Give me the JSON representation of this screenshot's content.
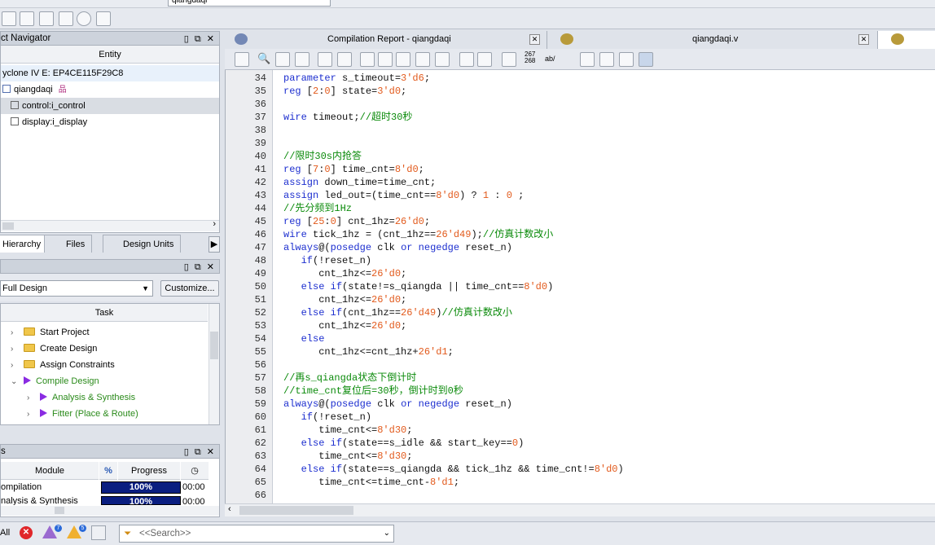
{
  "top_toolbar": {
    "project_combo": "qiangdaqi"
  },
  "project_navigator": {
    "title": "ct Navigator",
    "column_header": "Entity",
    "device": "yclone IV E: EP4CE115F29C8",
    "top_entity": "qiangdaqi",
    "children": [
      "control:i_control",
      "display:i_display"
    ],
    "tabs": [
      "Hierarchy",
      "Files",
      "Design Units"
    ]
  },
  "tasks": {
    "flow_select": "Full Design",
    "customize_label": "Customize...",
    "column_header": "Task",
    "items": [
      "Start Project",
      "Create Design",
      "Assign Constraints",
      "Compile Design",
      "Analysis & Synthesis",
      "Fitter (Place & Route)"
    ]
  },
  "status": {
    "title": "s",
    "col_module": "Module",
    "col_percent": "%",
    "col_progress": "Progress",
    "rows": [
      {
        "module": "ompilation",
        "progress": "100%",
        "time": "00:00"
      },
      {
        "module": "nalysis & Synthesis",
        "progress": "100%",
        "time": "00:00"
      }
    ]
  },
  "editor": {
    "tabs": [
      "Compilation Report - qiangdaqi",
      "qiangdaqi.v"
    ],
    "toolbar_labels": {
      "line_numbers": "267\n268",
      "abc": "ab/"
    },
    "lines": [
      {
        "n": "34",
        "t": "parameter s_timeout=3'd6;"
      },
      {
        "n": "35",
        "t": "reg [2:0] state=3'd0;"
      },
      {
        "n": "36",
        "t": ""
      },
      {
        "n": "37",
        "t": "wire timeout;//超时30秒"
      },
      {
        "n": "38",
        "t": ""
      },
      {
        "n": "39",
        "t": ""
      },
      {
        "n": "40",
        "t": "//限时30s内抢答"
      },
      {
        "n": "41",
        "t": "reg [7:0] time_cnt=8'd0;"
      },
      {
        "n": "42",
        "t": "assign down_time=time_cnt;"
      },
      {
        "n": "43",
        "t": "assign led_out=(time_cnt==8'd0) ? 1 : 0 ;"
      },
      {
        "n": "44",
        "t": "//先分频到1Hz"
      },
      {
        "n": "45",
        "t": "reg [25:0] cnt_1hz=26'd0;"
      },
      {
        "n": "46",
        "t": "wire tick_1hz = (cnt_1hz==26'd49);//仿真计数改小"
      },
      {
        "n": "47",
        "t": "always@(posedge clk or negedge reset_n)"
      },
      {
        "n": "48",
        "t": "   if(!reset_n)"
      },
      {
        "n": "49",
        "t": "      cnt_1hz<=26'd0;"
      },
      {
        "n": "50",
        "t": "   else if(state!=s_qiangda || time_cnt==8'd0)"
      },
      {
        "n": "51",
        "t": "      cnt_1hz<=26'd0;"
      },
      {
        "n": "52",
        "t": "   else if(cnt_1hz==26'd49)//仿真计数改小"
      },
      {
        "n": "53",
        "t": "      cnt_1hz<=26'd0;"
      },
      {
        "n": "54",
        "t": "   else"
      },
      {
        "n": "55",
        "t": "      cnt_1hz<=cnt_1hz+26'd1;"
      },
      {
        "n": "56",
        "t": ""
      },
      {
        "n": "57",
        "t": "//再s_qiangda状态下倒计时"
      },
      {
        "n": "58",
        "t": "//time_cnt复位后=30秒，倒计时到0秒"
      },
      {
        "n": "59",
        "t": "always@(posedge clk or negedge reset_n)"
      },
      {
        "n": "60",
        "t": "   if(!reset_n)"
      },
      {
        "n": "61",
        "t": "      time_cnt<=8'd30;"
      },
      {
        "n": "62",
        "t": "   else if(state==s_idle && start_key==0)"
      },
      {
        "n": "63",
        "t": "      time_cnt<=8'd30;"
      },
      {
        "n": "64",
        "t": "   else if(state==s_qiangda && tick_1hz && time_cnt!=8'd0)"
      },
      {
        "n": "65",
        "t": "      time_cnt<=time_cnt-8'd1;"
      },
      {
        "n": "66",
        "t": ""
      }
    ]
  },
  "bottom": {
    "all_label": "All",
    "badge_critical": "7",
    "badge_warning": "5",
    "search_placeholder": "<<Search>>"
  },
  "colors": {
    "keyword": "#1c2ecf",
    "number": "#e25a1c",
    "comment": "#0a8a0a",
    "progress": "#0a1e80"
  }
}
